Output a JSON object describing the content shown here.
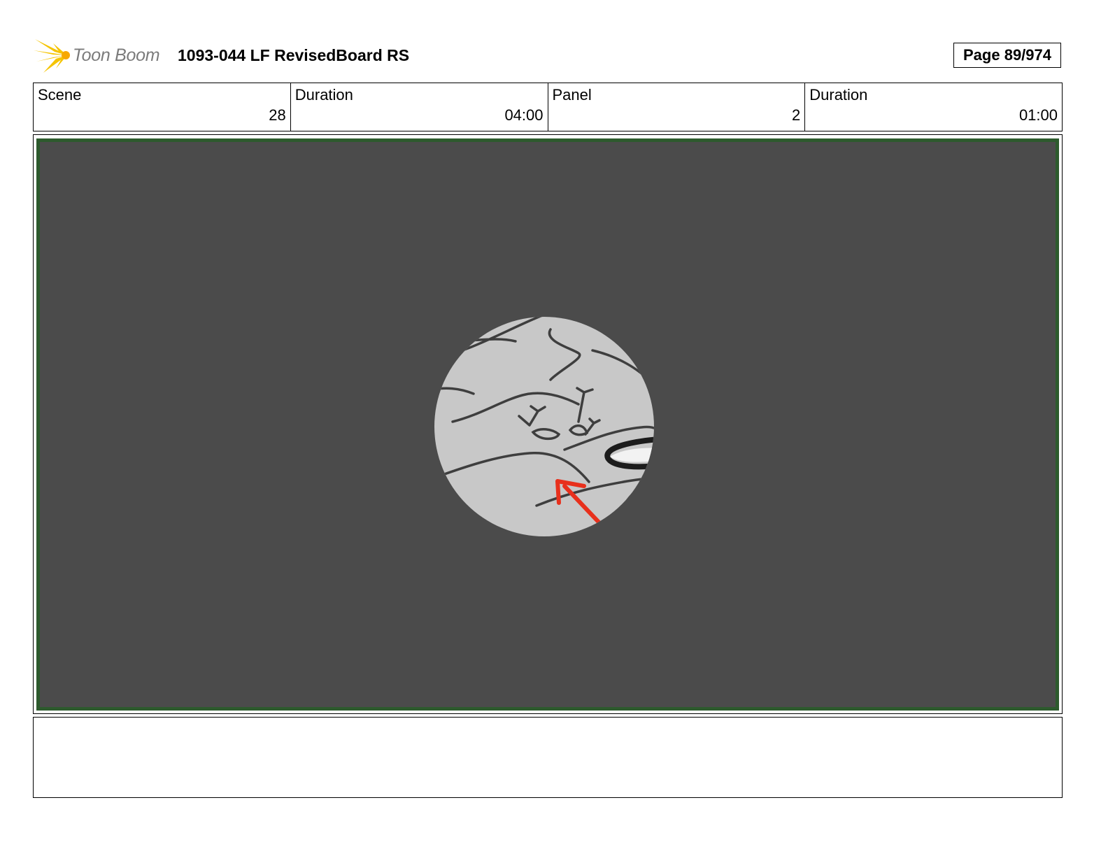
{
  "header": {
    "logo_text": "Toon Boom",
    "title": "1093-044 LF RevisedBoard RS",
    "page_label": "Page",
    "page_value": "89/974"
  },
  "info": {
    "scene_label": "Scene",
    "scene_value": "28",
    "scene_duration_label": "Duration",
    "scene_duration_value": "04:00",
    "panel_label": "Panel",
    "panel_value": "2",
    "panel_duration_label": "Duration",
    "panel_duration_value": "01:00"
  },
  "panel": {
    "description": "",
    "colors": {
      "background": "#4b4b4b",
      "frame": "#2d5a2d",
      "sketch_fill": "#c8c8c8",
      "line": "#3e3e3e",
      "arrow": "#e8301c"
    }
  },
  "notes": {
    "text": ""
  }
}
